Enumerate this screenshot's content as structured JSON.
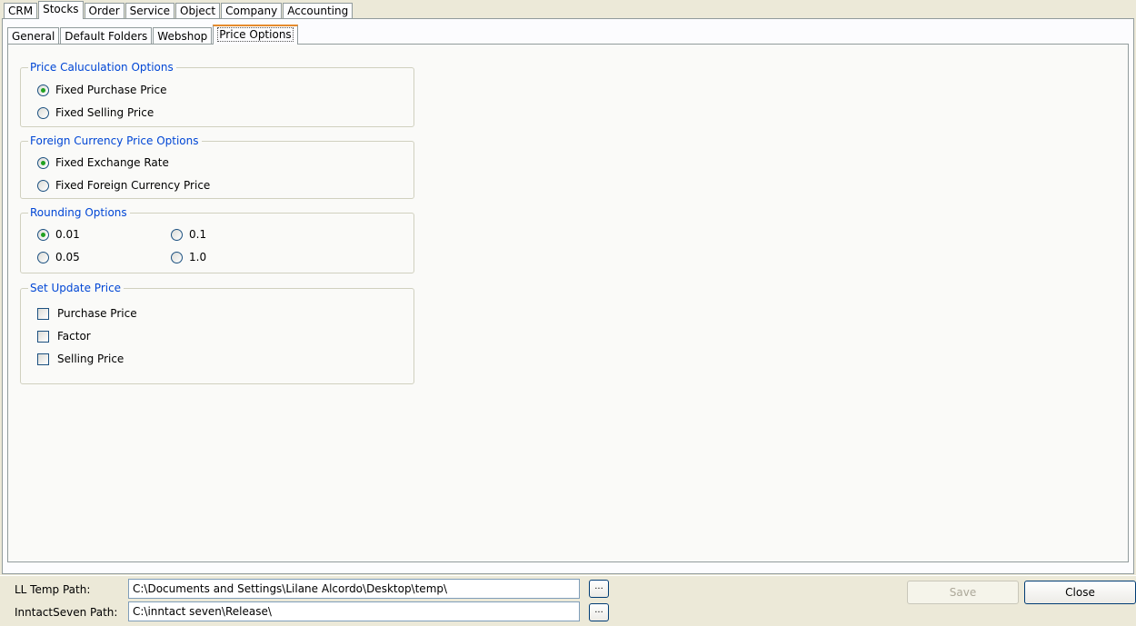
{
  "main_tabs": [
    "CRM",
    "Stocks",
    "Order",
    "Service",
    "Object",
    "Company",
    "Accounting"
  ],
  "main_tab_active": "Stocks",
  "sub_tabs": [
    "General",
    "Default Folders",
    "Webshop",
    "Price Options"
  ],
  "sub_tab_active": "Price Options",
  "price_calc": {
    "title": "Price Caluculation Options",
    "options": [
      "Fixed Purchase Price",
      "Fixed Selling Price"
    ],
    "selected": "Fixed Purchase Price"
  },
  "foreign_currency": {
    "title": "Foreign Currency Price Options",
    "options": [
      "Fixed Exchange Rate",
      "Fixed Foreign Currency Price"
    ],
    "selected": "Fixed Exchange Rate"
  },
  "rounding": {
    "title": "Rounding Options",
    "options": [
      "0.01",
      "0.1",
      "0.05",
      "1.0"
    ],
    "selected": "0.01"
  },
  "update_price": {
    "title": "Set Update Price",
    "options": [
      "Purchase Price",
      "Factor",
      "Selling Price"
    ],
    "checked": []
  },
  "paths": {
    "ll_temp_label": "LL Temp Path:",
    "ll_temp_value": "C:\\Documents and Settings\\Lilane Alcordo\\Desktop\\temp\\",
    "inntact_label": "InntactSeven Path:",
    "inntact_value": "C:\\inntact seven\\Release\\",
    "browse_label": "..."
  },
  "buttons": {
    "save": "Save",
    "close": "Close"
  }
}
